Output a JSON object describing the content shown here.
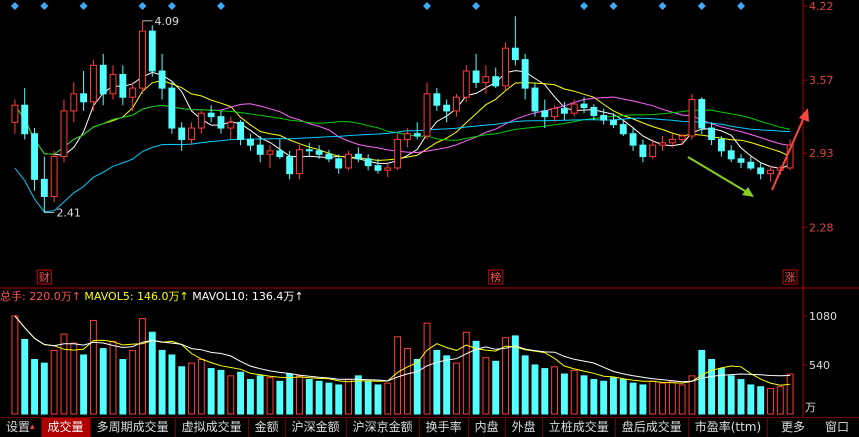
{
  "chart_data": {
    "type": "candlestick",
    "price_axis": {
      "ticks": [
        "4.22",
        "3.57",
        "2.93",
        "2.28"
      ],
      "values": [
        4.22,
        3.57,
        2.93,
        2.28
      ]
    },
    "price_range": [
      1.8,
      4.22
    ],
    "annotations": {
      "high": "4.09",
      "low": "2.41"
    },
    "event_markers": [
      "财",
      "榜",
      "涨"
    ],
    "candles": [
      [
        3.2,
        3.4,
        3.1,
        3.35
      ],
      [
        3.35,
        3.5,
        3.05,
        3.1
      ],
      [
        3.1,
        3.15,
        2.6,
        2.7
      ],
      [
        2.7,
        2.9,
        2.41,
        2.55
      ],
      [
        2.55,
        2.95,
        2.5,
        2.9
      ],
      [
        2.9,
        3.4,
        2.85,
        3.3
      ],
      [
        3.3,
        3.55,
        3.2,
        3.45
      ],
      [
        3.45,
        3.65,
        3.3,
        3.38
      ],
      [
        3.38,
        3.75,
        3.3,
        3.7
      ],
      [
        3.7,
        3.8,
        3.35,
        3.45
      ],
      [
        3.45,
        3.7,
        3.4,
        3.62
      ],
      [
        3.62,
        3.7,
        3.35,
        3.42
      ],
      [
        3.42,
        3.55,
        3.3,
        3.5
      ],
      [
        3.5,
        4.09,
        3.45,
        4.0
      ],
      [
        4.0,
        4.05,
        3.6,
        3.65
      ],
      [
        3.65,
        3.8,
        3.4,
        3.5
      ],
      [
        3.5,
        3.55,
        3.1,
        3.15
      ],
      [
        3.15,
        3.2,
        2.95,
        3.05
      ],
      [
        3.05,
        3.2,
        3.0,
        3.15
      ],
      [
        3.15,
        3.3,
        3.1,
        3.28
      ],
      [
        3.28,
        3.35,
        3.2,
        3.25
      ],
      [
        3.25,
        3.3,
        3.1,
        3.15
      ],
      [
        3.15,
        3.25,
        3.05,
        3.2
      ],
      [
        3.2,
        3.22,
        3.0,
        3.05
      ],
      [
        3.05,
        3.1,
        2.95,
        3.0
      ],
      [
        3.0,
        3.08,
        2.85,
        2.92
      ],
      [
        2.92,
        3.0,
        2.8,
        2.95
      ],
      [
        2.95,
        3.05,
        2.88,
        2.9
      ],
      [
        2.9,
        2.95,
        2.7,
        2.75
      ],
      [
        2.75,
        3.0,
        2.7,
        2.96
      ],
      [
        2.96,
        3.02,
        2.9,
        2.95
      ],
      [
        2.95,
        3.0,
        2.88,
        2.92
      ],
      [
        2.92,
        2.96,
        2.85,
        2.88
      ],
      [
        2.88,
        2.92,
        2.75,
        2.8
      ],
      [
        2.8,
        2.95,
        2.78,
        2.92
      ],
      [
        2.92,
        2.98,
        2.85,
        2.88
      ],
      [
        2.88,
        2.92,
        2.78,
        2.82
      ],
      [
        2.82,
        2.88,
        2.75,
        2.78
      ],
      [
        2.78,
        2.85,
        2.72,
        2.8
      ],
      [
        2.8,
        3.1,
        2.78,
        3.05
      ],
      [
        3.05,
        3.15,
        2.98,
        3.1
      ],
      [
        3.1,
        3.2,
        3.05,
        3.08
      ],
      [
        3.08,
        3.55,
        3.05,
        3.45
      ],
      [
        3.45,
        3.5,
        3.3,
        3.35
      ],
      [
        3.35,
        3.4,
        3.2,
        3.3
      ],
      [
        3.3,
        3.45,
        3.25,
        3.42
      ],
      [
        3.42,
        3.7,
        3.38,
        3.65
      ],
      [
        3.65,
        3.8,
        3.5,
        3.55
      ],
      [
        3.55,
        3.7,
        3.45,
        3.6
      ],
      [
        3.6,
        3.68,
        3.5,
        3.52
      ],
      [
        3.52,
        3.9,
        3.48,
        3.85
      ],
      [
        3.85,
        4.13,
        3.7,
        3.75
      ],
      [
        3.75,
        3.8,
        3.4,
        3.5
      ],
      [
        3.5,
        3.55,
        3.25,
        3.3
      ],
      [
        3.3,
        3.4,
        3.15,
        3.25
      ],
      [
        3.25,
        3.35,
        3.2,
        3.32
      ],
      [
        3.32,
        3.38,
        3.22,
        3.28
      ],
      [
        3.28,
        3.4,
        3.25,
        3.36
      ],
      [
        3.36,
        3.42,
        3.28,
        3.33
      ],
      [
        3.33,
        3.36,
        3.22,
        3.26
      ],
      [
        3.26,
        3.32,
        3.18,
        3.22
      ],
      [
        3.22,
        3.28,
        3.15,
        3.18
      ],
      [
        3.18,
        3.22,
        3.08,
        3.1
      ],
      [
        3.1,
        3.15,
        2.95,
        3.0
      ],
      [
        3.0,
        3.05,
        2.85,
        2.9
      ],
      [
        2.9,
        3.05,
        2.88,
        3.0
      ],
      [
        3.0,
        3.08,
        2.95,
        3.02
      ],
      [
        3.02,
        3.1,
        2.98,
        3.05
      ],
      [
        3.05,
        3.1,
        3.0,
        3.08
      ],
      [
        3.08,
        3.45,
        3.05,
        3.4
      ],
      [
        3.4,
        3.42,
        3.1,
        3.15
      ],
      [
        3.15,
        3.2,
        3.0,
        3.05
      ],
      [
        3.05,
        3.08,
        2.9,
        2.95
      ],
      [
        2.95,
        3.0,
        2.85,
        2.88
      ],
      [
        2.88,
        2.92,
        2.8,
        2.85
      ],
      [
        2.85,
        2.9,
        2.78,
        2.8
      ],
      [
        2.8,
        2.85,
        2.7,
        2.75
      ],
      [
        2.75,
        2.82,
        2.68,
        2.78
      ],
      [
        2.78,
        2.82,
        2.74,
        2.8
      ],
      [
        2.8,
        3.05,
        2.78,
        3.0
      ]
    ],
    "ma_lines": [
      {
        "name": "MA5",
        "color": "#ffffff",
        "values": []
      },
      {
        "name": "MA10",
        "color": "#ffff00",
        "values": []
      },
      {
        "name": "MA20",
        "color": "#ff66ff",
        "values": []
      },
      {
        "name": "MA30",
        "color": "#00cc00",
        "values": []
      },
      {
        "name": "MA60",
        "color": "#00ccff",
        "values": []
      }
    ],
    "volume": {
      "header": "总手: 220.0万↑",
      "mavol5_label": "MAVOL5: 146.0万↑",
      "mavol10_label": "MAVOL10: 136.4万↑",
      "axis": {
        "ticks": [
          "1080",
          "540",
          "万"
        ],
        "values": [
          1080,
          540
        ]
      },
      "values": [
        1080,
        820,
        600,
        560,
        700,
        880,
        780,
        650,
        1030,
        720,
        800,
        600,
        700,
        1050,
        900,
        700,
        650,
        520,
        560,
        600,
        500,
        480,
        420,
        460,
        380,
        420,
        400,
        360,
        440,
        420,
        380,
        360,
        340,
        320,
        380,
        420,
        360,
        320,
        340,
        850,
        720,
        600,
        1000,
        700,
        640,
        560,
        900,
        800,
        620,
        580,
        840,
        860,
        640,
        540,
        500,
        520,
        440,
        480,
        420,
        380,
        360,
        400,
        380,
        340,
        320,
        360,
        340,
        360,
        320,
        420,
        700,
        600,
        500,
        420,
        380,
        320,
        300,
        280,
        300,
        440
      ]
    },
    "arrows": [
      {
        "color": "#88cc22",
        "direction": "down"
      },
      {
        "color": "#ff4444",
        "direction": "up"
      }
    ]
  },
  "markers": {
    "diamond_color": "#3fa9f5"
  },
  "tabs": [
    "设置",
    "成交量",
    "多周期成交量",
    "虚拟成交量",
    "金额",
    "沪深金额",
    "沪深京金额",
    "换手率",
    "内盘",
    "外盘",
    "立桩成交量",
    "盘后成交量",
    "市盈率(ttm)"
  ],
  "active_tab": "成交量",
  "right_links": [
    "更多",
    "窗口"
  ],
  "colors": {
    "up": "#ff3b3b",
    "down": "#54ffff",
    "axis": "#b00000",
    "text": "#cccccc"
  }
}
